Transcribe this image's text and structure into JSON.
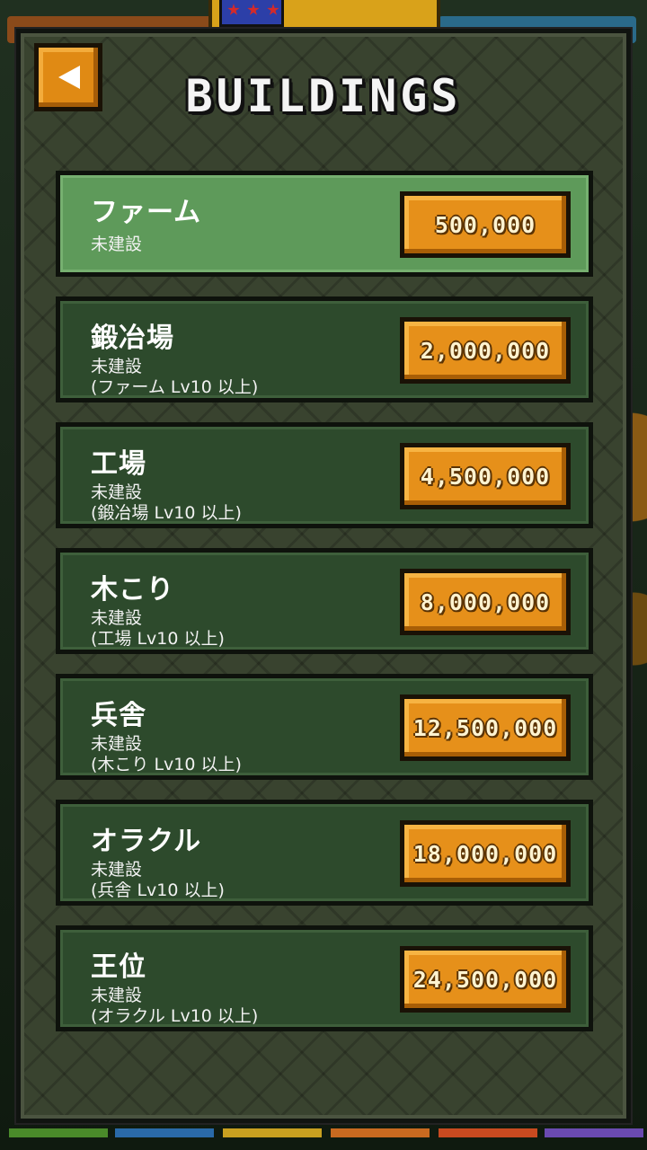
{
  "screen": {
    "title": "BUILDINGS",
    "back_icon": "back-arrow-icon"
  },
  "colors": {
    "row_default": "#2d4a2c",
    "row_active": "#5e9a5a",
    "price_button": "#e6901a",
    "panel": "#39432f"
  },
  "buildings": [
    {
      "name": "ファーム",
      "status": "未建設",
      "requirement": "",
      "price": "500,000",
      "active": true
    },
    {
      "name": "鍛冶場",
      "status": "未建設",
      "requirement": "(ファーム Lv10 以上)",
      "price": "2,000,000",
      "active": false
    },
    {
      "name": "工場",
      "status": "未建設",
      "requirement": "(鍛冶場 Lv10 以上)",
      "price": "4,500,000",
      "active": false
    },
    {
      "name": "木こり",
      "status": "未建設",
      "requirement": "(工場 Lv10 以上)",
      "price": "8,000,000",
      "active": false
    },
    {
      "name": "兵舎",
      "status": "未建設",
      "requirement": "(木こり Lv10 以上)",
      "price": "12,500,000",
      "active": false
    },
    {
      "name": "オラクル",
      "status": "未建設",
      "requirement": "(兵舎 Lv10 以上)",
      "price": "18,000,000",
      "active": false
    },
    {
      "name": "王位",
      "status": "未建設",
      "requirement": "(オラクル Lv10 以上)",
      "price": "24,500,000",
      "active": false
    }
  ]
}
